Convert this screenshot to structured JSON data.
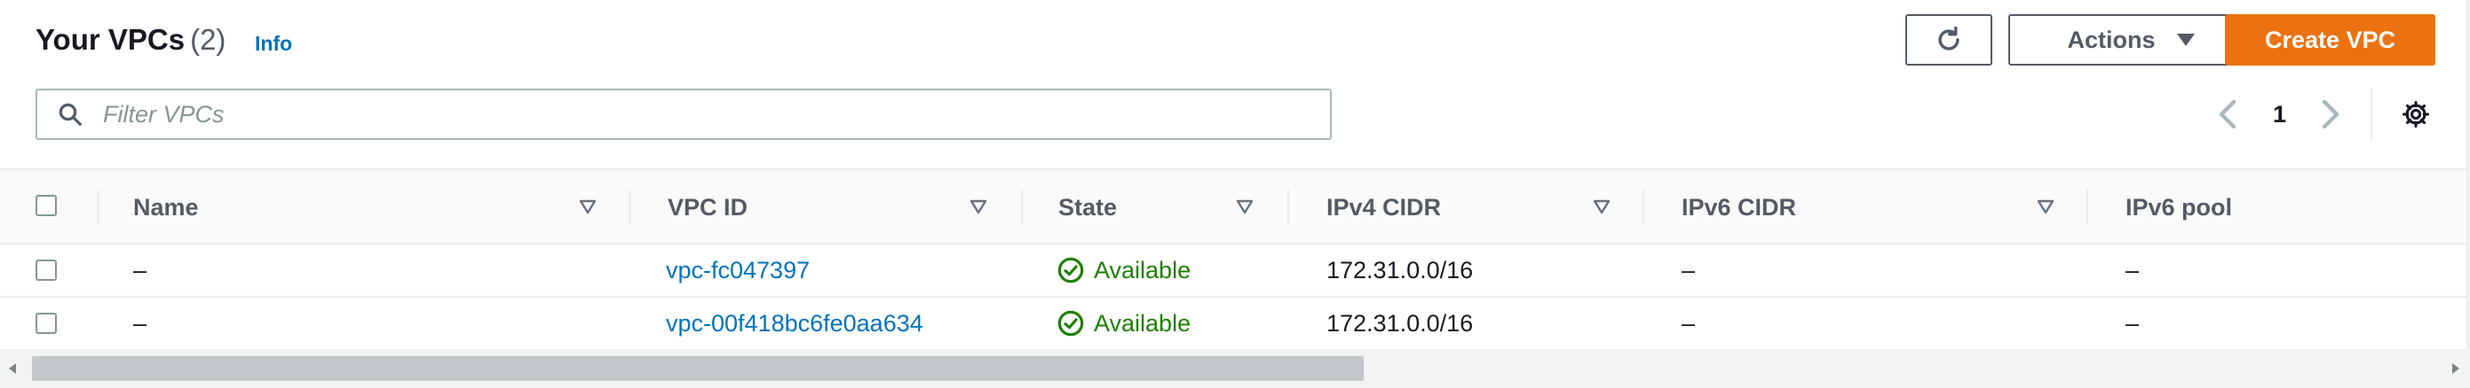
{
  "header": {
    "title": "Your VPCs",
    "count": "(2)",
    "info": "Info"
  },
  "toolbar": {
    "refresh_icon": "refresh-icon",
    "actions_label": "Actions",
    "create_label": "Create VPC",
    "accent_color": "#ec7211"
  },
  "filter": {
    "placeholder": "Filter VPCs",
    "value": ""
  },
  "pagination": {
    "page": "1"
  },
  "table": {
    "columns": [
      "Name",
      "VPC ID",
      "State",
      "IPv4 CIDR",
      "IPv6 CIDR",
      "IPv6 pool"
    ],
    "rows": [
      {
        "name": "–",
        "vpc_id": "vpc-fc047397",
        "state": "Available",
        "ipv4": "172.31.0.0/16",
        "ipv6": "–",
        "pool": "–"
      },
      {
        "name": "–",
        "vpc_id": "vpc-00f418bc6fe0aa634",
        "state": "Available",
        "ipv4": "172.31.0.0/16",
        "ipv6": "–",
        "pool": "–"
      }
    ]
  },
  "colors": {
    "link": "#0073bb",
    "status_ok": "#1d8102"
  }
}
